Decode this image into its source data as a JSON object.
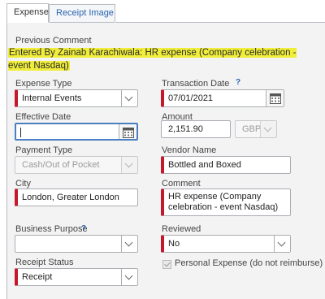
{
  "tabs": [
    {
      "label": "Expense",
      "active": true
    },
    {
      "label": "Receipt Image",
      "active": false
    }
  ],
  "previous_comment": {
    "label": "Previous Comment",
    "text": "Entered By Zainab Karachiwala: HR expense (Company celebration - event Nasdaq)"
  },
  "expense_type": {
    "label": "Expense Type",
    "value": "Internal Events"
  },
  "transaction_date": {
    "label": "Transaction Date",
    "value": "07/01/2021"
  },
  "effective_date": {
    "label": "Effective Date",
    "value": ""
  },
  "amount": {
    "label": "Amount",
    "value": "2,151.90",
    "currency": "GBP"
  },
  "payment_type": {
    "label": "Payment Type",
    "value": "Cash/Out of Pocket"
  },
  "vendor_name": {
    "label": "Vendor Name",
    "value": "Bottled and Boxed"
  },
  "city": {
    "label": "City",
    "value": "London, Greater London"
  },
  "comment": {
    "label": "Comment",
    "value": "HR expense (Company celebration - event Nasdaq)"
  },
  "business_purpose": {
    "label": "Business Purpose",
    "value": ""
  },
  "reviewed": {
    "label": "Reviewed",
    "value": "No"
  },
  "receipt_status": {
    "label": "Receipt Status",
    "value": "Receipt"
  },
  "personal_expense": {
    "label": "Personal Expense (do not reimburse)",
    "checked": true
  },
  "colors": {
    "required_marker": "#c4182c",
    "highlight": "#f0ee3a",
    "link": "#2a64b0",
    "focus": "#4a7fc1"
  },
  "icons": {
    "help": "question-mark-icon",
    "calendar": "calendar-icon",
    "dropdown": "chevron-down-icon"
  }
}
